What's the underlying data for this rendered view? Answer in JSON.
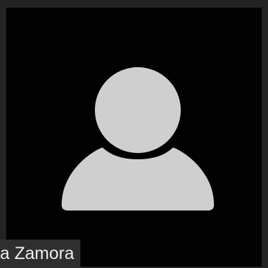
{
  "participant": {
    "name_label": "a Zamora",
    "avatar_icon": "user-silhouette-icon"
  },
  "colors": {
    "tile_frame": "#232323",
    "video_background": "#020202",
    "avatar_fill": "#cfcfcf",
    "name_label_background": "#2f2f2f",
    "name_label_text": "#eeeeee"
  }
}
